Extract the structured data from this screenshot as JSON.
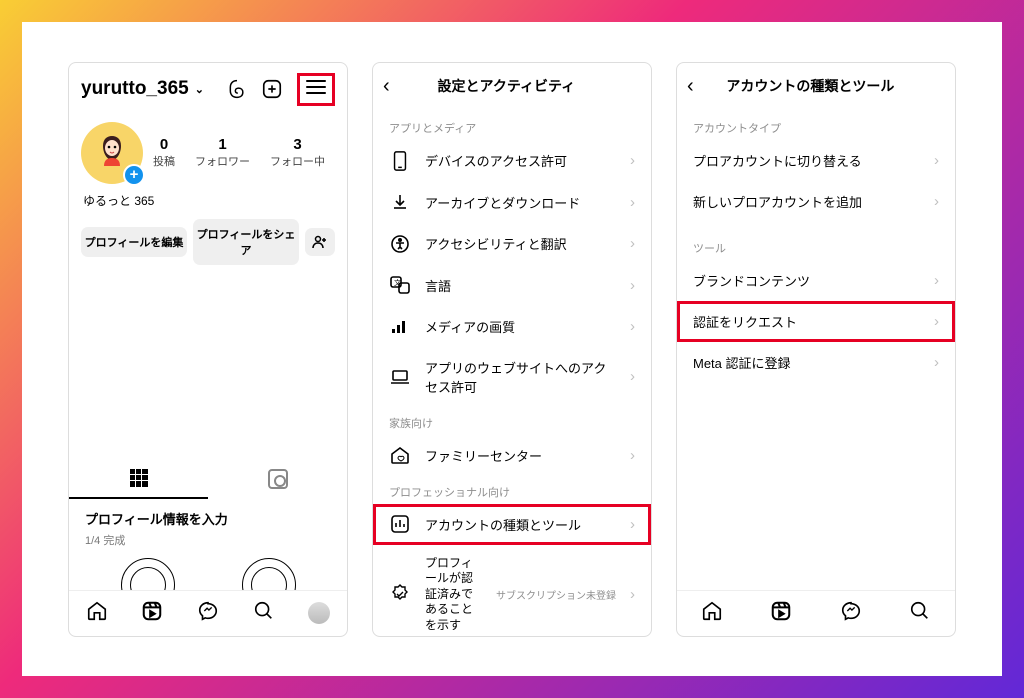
{
  "panel1": {
    "username": "yurutto_365",
    "stats": {
      "posts": {
        "value": "0",
        "label": "投稿"
      },
      "followers": {
        "value": "1",
        "label": "フォロワー"
      },
      "following": {
        "value": "3",
        "label": "フォロー中"
      }
    },
    "display_name": "ゆるっと 365",
    "edit_btn": "プロフィールを編集",
    "share_btn": "プロフィールをシェア",
    "prompt_title": "プロフィール情報を入力",
    "prompt_sub": "1/4 完成"
  },
  "panel2": {
    "title": "設定とアクティビティ",
    "section_app": "アプリとメディア",
    "rows_app": [
      {
        "label": "デバイスのアクセス許可"
      },
      {
        "label": "アーカイブとダウンロード"
      },
      {
        "label": "アクセシビリティと翻訳"
      },
      {
        "label": "言語"
      },
      {
        "label": "メディアの画質"
      },
      {
        "label": "アプリのウェブサイトへのアクセス許可"
      }
    ],
    "section_family": "家族向け",
    "row_family": "ファミリーセンター",
    "section_pro": "プロフェッショナル向け",
    "row_tools": "アカウントの種類とツール",
    "row_verify_main": "プロフィールが認証済みであることを示す",
    "row_verify_side": "サブスクリプション未登録"
  },
  "panel3": {
    "title": "アカウントの種類とツール",
    "section_type": "アカウントタイプ",
    "row_switch": "プロアカウントに切り替える",
    "row_addnew": "新しいプロアカウントを追加",
    "section_tools": "ツール",
    "row_brand": "ブランドコンテンツ",
    "row_request": "認証をリクエスト",
    "row_meta": "Meta 認証に登録"
  }
}
